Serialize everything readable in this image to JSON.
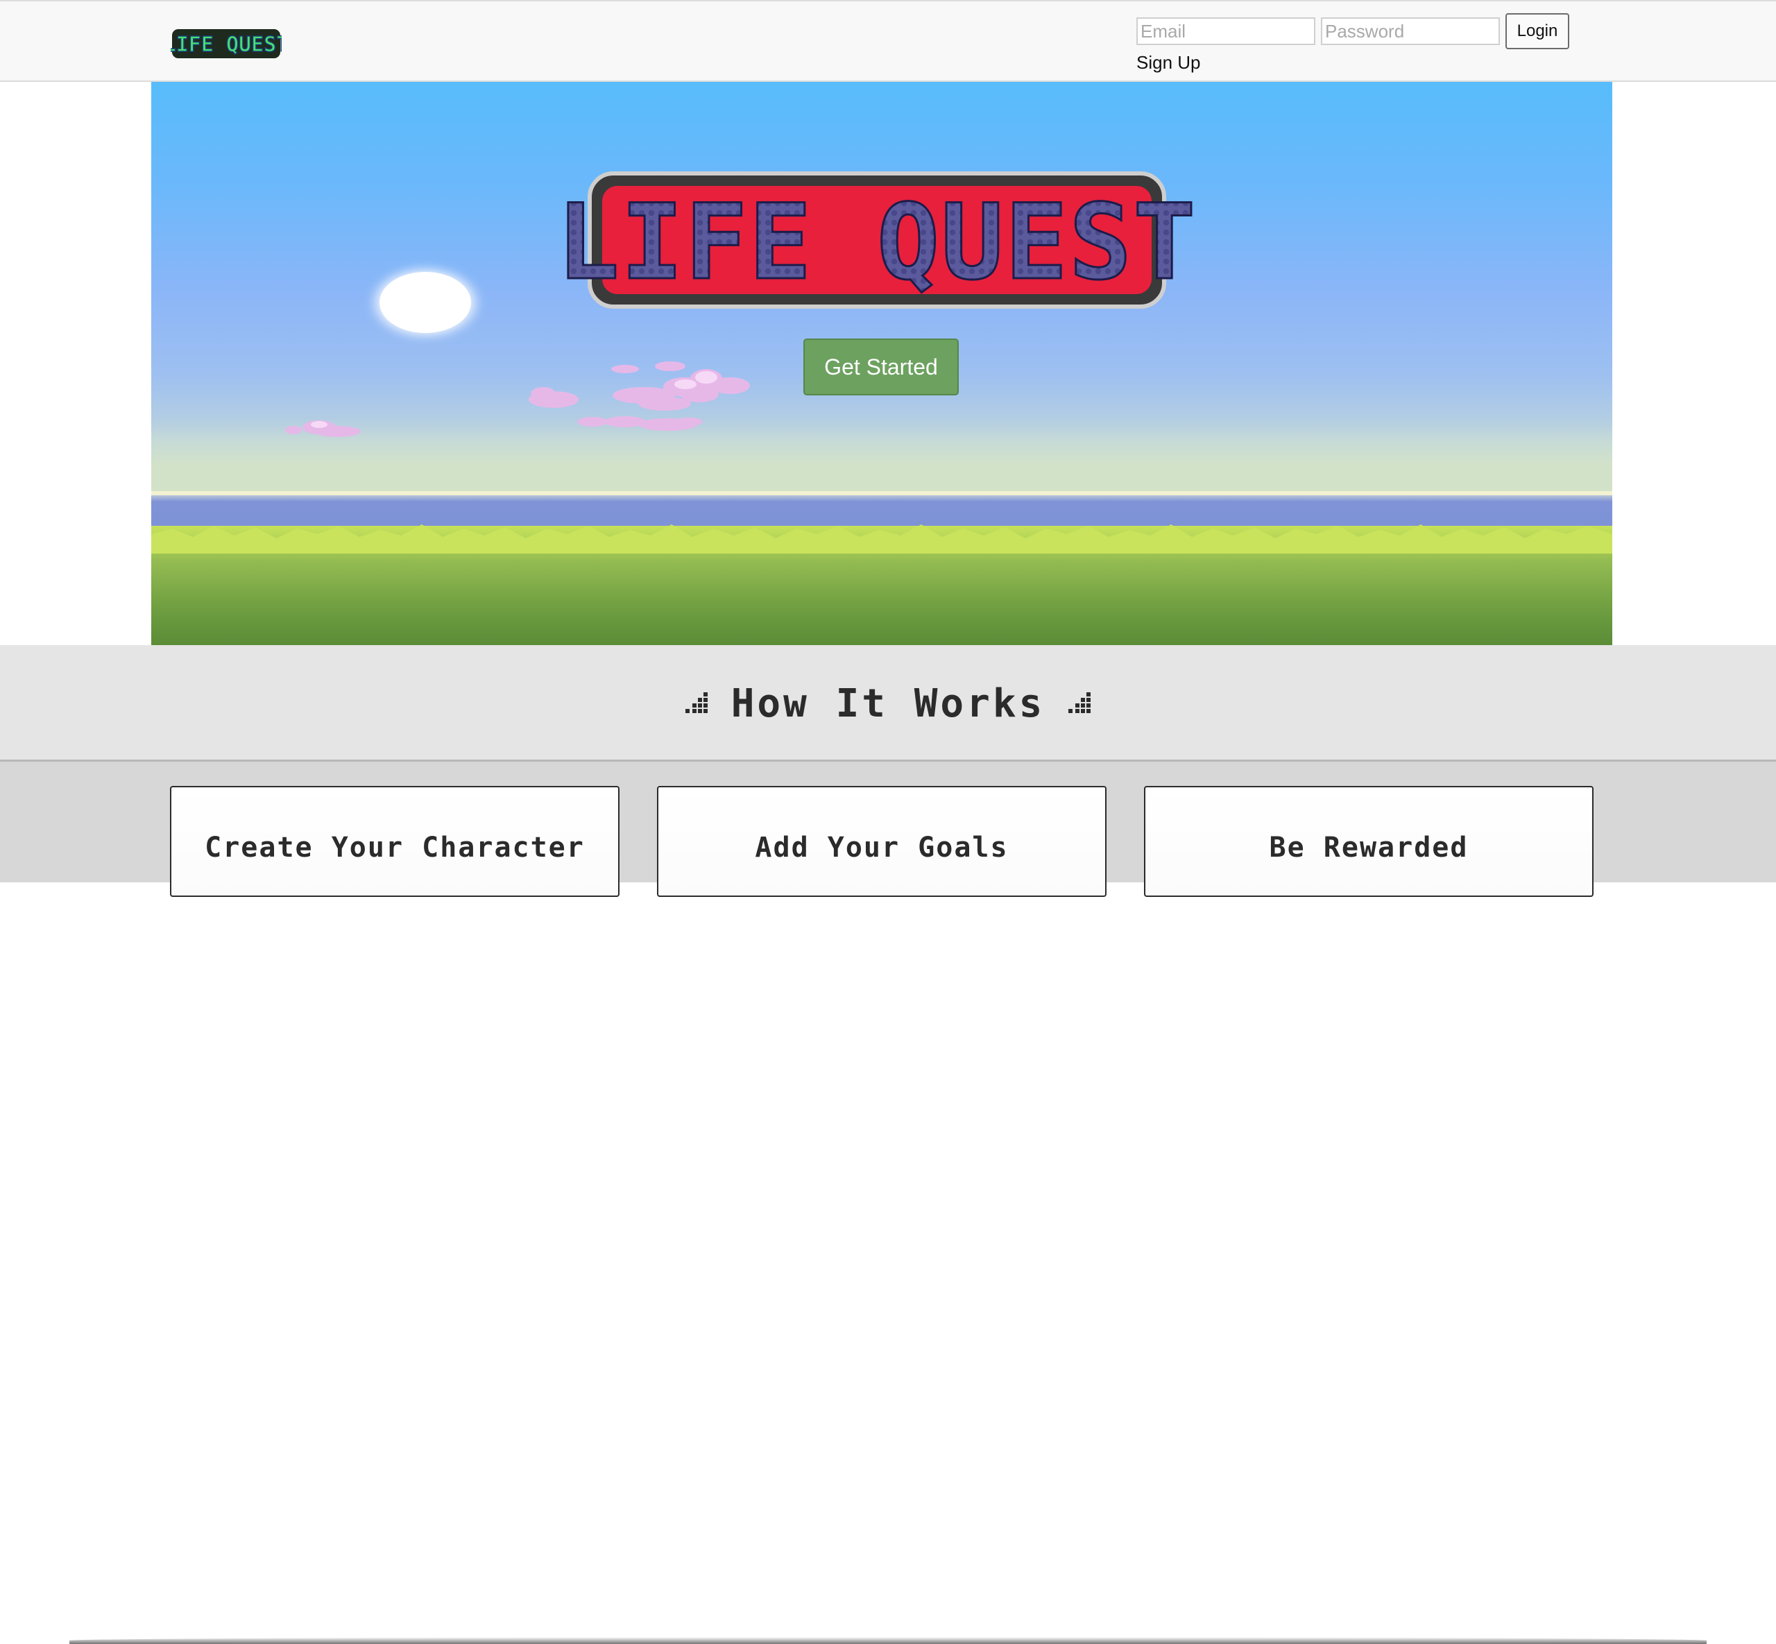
{
  "navbar": {
    "brand_text": "LIFE QUEST",
    "email_placeholder": "Email",
    "password_placeholder": "Password",
    "login_label": "Login",
    "signup_label": "Sign Up"
  },
  "hero": {
    "logo_text": "LIFE QUEST",
    "cta_label": "Get Started"
  },
  "how_it_works": {
    "title": "How It Works",
    "steps": [
      {
        "title": "Create Your Character"
      },
      {
        "title": "Add Your Goals"
      },
      {
        "title": "Be Rewarded"
      }
    ]
  },
  "colors": {
    "cta_background": "#6da160",
    "logo_fill": "#5c5ca0",
    "logo_outline": "#e8203c",
    "brand_fill": "#3dd66a"
  },
  "icons": [
    "pixel-equalizer-icon"
  ]
}
